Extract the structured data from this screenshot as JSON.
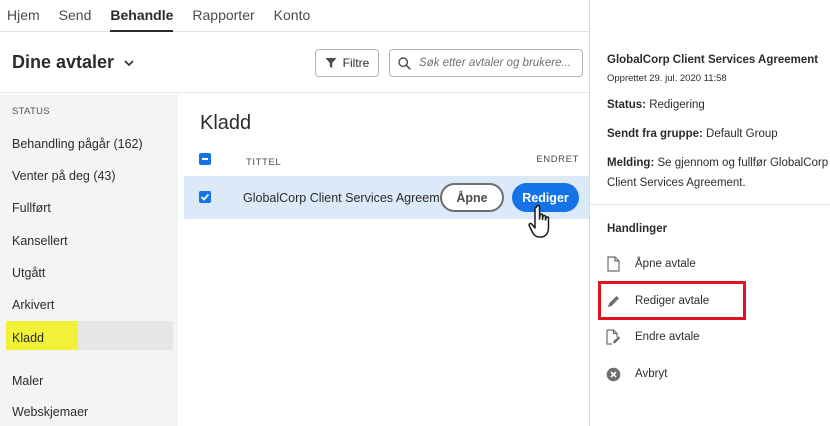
{
  "nav": {
    "tabs": [
      {
        "label": "Hjem"
      },
      {
        "label": "Send"
      },
      {
        "label": "Behandle"
      },
      {
        "label": "Rapporter"
      },
      {
        "label": "Konto"
      }
    ],
    "active_tab": "Behandle"
  },
  "header": {
    "title": "Dine avtaler",
    "filter_label": "Filtre",
    "search_placeholder": "Søk etter avtaler og brukere..."
  },
  "sidebar": {
    "section_label": "STATUS",
    "items": [
      {
        "label": "Behandling pågår (162)"
      },
      {
        "label": "Venter på deg (43)"
      },
      {
        "label": "Fullført"
      },
      {
        "label": "Kansellert"
      },
      {
        "label": "Utgått"
      },
      {
        "label": "Arkivert"
      },
      {
        "label": "Kladd"
      },
      {
        "label": "Maler"
      },
      {
        "label": "Webskjemaer"
      }
    ],
    "selected": "Kladd"
  },
  "main": {
    "heading": "Kladd",
    "columns": {
      "title": "TITTEL",
      "changed": "ENDRET"
    },
    "rows": [
      {
        "name": "GlobalCorp Client Services Agreement",
        "open_label": "Åpne",
        "edit_label": "Rediger"
      }
    ]
  },
  "panel": {
    "title": "GlobalCorp Client Services Agreement",
    "created": "Opprettet 29. jul. 2020 11:58",
    "status_label": "Status:",
    "status_value": "Redigering",
    "group_label": "Sendt fra gruppe:",
    "group_value": "Default Group",
    "message_label": "Melding:",
    "message_value": "Se gjennom og fullfør GlobalCorp Client Services Agreement.",
    "actions_title": "Handlinger",
    "actions": [
      {
        "label": "Åpne avtale",
        "icon": "document-icon"
      },
      {
        "label": "Rediger avtale",
        "icon": "pencil-icon"
      },
      {
        "label": "Endre avtale",
        "icon": "document-edit-icon"
      },
      {
        "label": "Avbryt",
        "icon": "cancel-circle-icon"
      }
    ]
  },
  "colors": {
    "accent_blue": "#1473e6",
    "row_selected": "#dce9f8",
    "highlight_yellow": "#f1f237",
    "callout_red": "#e0131f"
  }
}
